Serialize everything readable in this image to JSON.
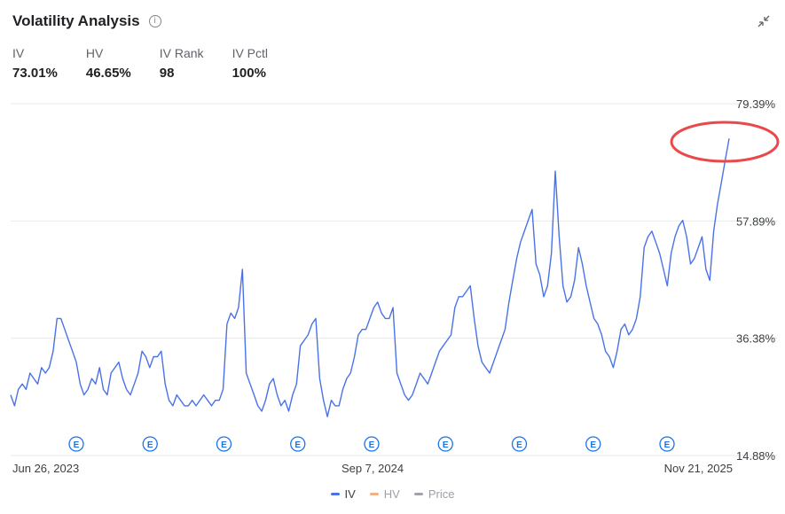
{
  "header": {
    "title": "Volatility Analysis",
    "info_icon": "info-icon",
    "expand_icon": "collapse-arrows-icon"
  },
  "stats": [
    {
      "label": "IV",
      "value": "73.01%"
    },
    {
      "label": "HV",
      "value": "46.65%"
    },
    {
      "label": "IV Rank",
      "value": "98"
    },
    {
      "label": "IV Pctl",
      "value": "100%"
    }
  ],
  "colors": {
    "iv": "#4a72e8",
    "hv": "#f4b183",
    "price": "#a0a4aa",
    "grid": "#e8eaed",
    "earnings": "#1a73e8",
    "highlight": "#e8494a"
  },
  "legend": [
    {
      "label": "IV",
      "color": "#4a72e8"
    },
    {
      "label": "HV",
      "color": "#f4b183"
    },
    {
      "label": "Price",
      "color": "#a0a4aa"
    }
  ],
  "chart_data": {
    "type": "line",
    "y_ticks": [
      "79.39%",
      "57.89%",
      "36.38%",
      "14.88%"
    ],
    "ylim": [
      14.88,
      79.39
    ],
    "x_labels": [
      "Jun 26, 2023",
      "Sep 7, 2024",
      "Nov 21, 2025"
    ],
    "earnings_marker_label": "E",
    "earnings_count": 9,
    "series": [
      {
        "name": "IV",
        "values": [
          26,
          24,
          27,
          28,
          27,
          30,
          29,
          28,
          31,
          30,
          31,
          34,
          40,
          40,
          38,
          36,
          34,
          32,
          28,
          26,
          27,
          29,
          28,
          31,
          27,
          26,
          30,
          31,
          32,
          29,
          27,
          26,
          28,
          30,
          34,
          33,
          31,
          33,
          33,
          34,
          28,
          25,
          24,
          26,
          25,
          24,
          24,
          25,
          24,
          25,
          26,
          25,
          24,
          25,
          25,
          27,
          39,
          41,
          40,
          42,
          49,
          30,
          28,
          26,
          24,
          23,
          25,
          28,
          29,
          26,
          24,
          25,
          23,
          26,
          28,
          35,
          36,
          37,
          39,
          40,
          29,
          25,
          22,
          25,
          24,
          24,
          27,
          29,
          30,
          33,
          37,
          38,
          38,
          40,
          42,
          43,
          41,
          40,
          40,
          42,
          30,
          28,
          26,
          25,
          26,
          28,
          30,
          29,
          28,
          30,
          32,
          34,
          35,
          36,
          37,
          42,
          44,
          44,
          45,
          46,
          40,
          35,
          32,
          31,
          30,
          32,
          34,
          36,
          38,
          43,
          47,
          51,
          54,
          56,
          58,
          60,
          50,
          48,
          44,
          46,
          52,
          67,
          55,
          46,
          43,
          44,
          47,
          53,
          50,
          46,
          43,
          40,
          39,
          37,
          34,
          33,
          31,
          34,
          38,
          39,
          37,
          38,
          40,
          44,
          53,
          55,
          56,
          54,
          52,
          49,
          46,
          52,
          55,
          57,
          58,
          55,
          50,
          51,
          53,
          55,
          49,
          47,
          56,
          61,
          65,
          69,
          73
        ]
      }
    ]
  }
}
